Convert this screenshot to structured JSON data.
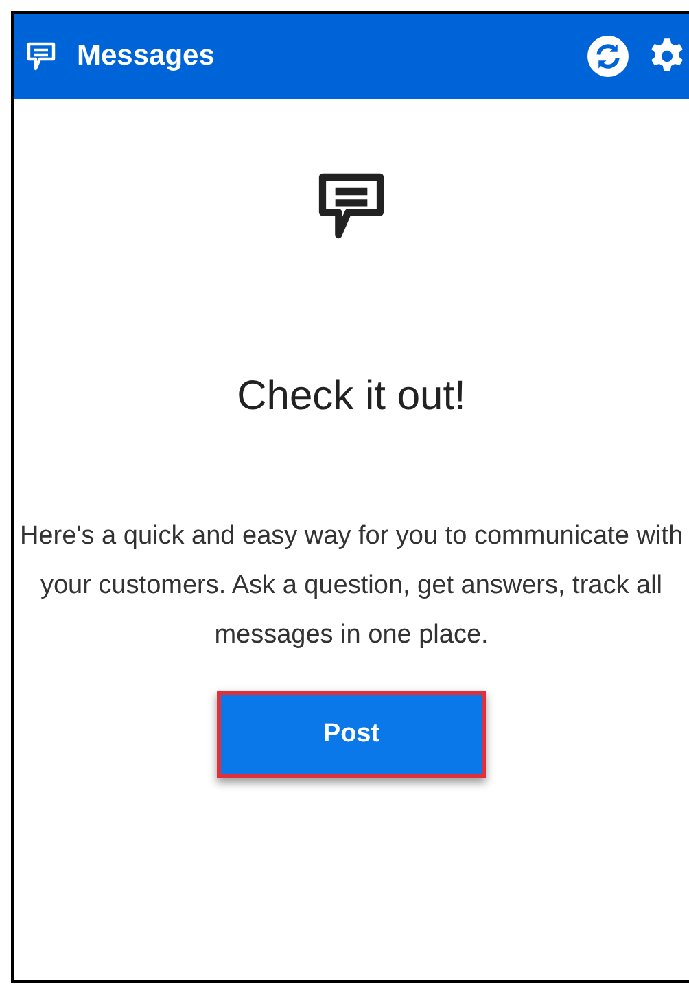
{
  "header": {
    "title": "Messages"
  },
  "empty_state": {
    "heading": "Check it out!",
    "description": "Here's a quick and easy way for you to communicate with your customers. Ask a question, get answers, track all messages in one place."
  },
  "button": {
    "label": "Post",
    "highlighted": true
  }
}
